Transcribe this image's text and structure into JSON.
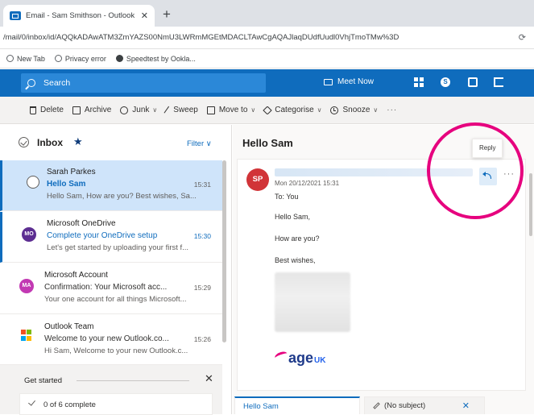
{
  "browser": {
    "tab_title": "Email - Sam Smithson - Outlook",
    "tab_close": "✕",
    "new_tab": "+",
    "url": "/mail/0/inbox/id/AQQkADAwATM3ZmYAZS00NmU3LWRmMGEtMDACLTAwCgAQAJlaqDUdfUudl0VhjTmoTMw%3D",
    "url_right_icon": "extensions-icon",
    "bookmarks": [
      {
        "label": "New Tab",
        "icon": "globe-icon"
      },
      {
        "label": "Privacy error",
        "icon": "globe-icon"
      },
      {
        "label": "Speedtest by Ookla...",
        "icon": "speedtest-icon"
      }
    ]
  },
  "header": {
    "search_placeholder": "Search",
    "meet_now": "Meet Now",
    "brand_color": "#0f6cbd"
  },
  "commands": {
    "delete": "Delete",
    "archive": "Archive",
    "junk": "Junk",
    "sweep": "Sweep",
    "move_to": "Move to",
    "categorise": "Categorise",
    "snooze": "Snooze",
    "more": "···"
  },
  "list": {
    "folder": "Inbox",
    "filter": "Filter",
    "messages": [
      {
        "initials": "",
        "sender": "Sarah Parkes",
        "subject": "Hello Sam",
        "time": "15:31",
        "preview": "Hello Sam, How are you? Best wishes, Sa..."
      },
      {
        "initials": "MO",
        "sender": "Microsoft OneDrive",
        "subject": "Complete your OneDrive setup",
        "time": "15:30",
        "preview": "Let's get started by uploading your first f..."
      },
      {
        "initials": "MA",
        "sender": "Microsoft Account",
        "subject": "Confirmation: Your Microsoft acc...",
        "time": "15:29",
        "preview": "Your one account for all things Microsoft..."
      },
      {
        "initials": "",
        "sender": "Outlook Team",
        "subject": "Welcome to your new Outlook.co...",
        "time": "15:26",
        "preview": "Hi Sam, Welcome to your new Outlook.c..."
      }
    ],
    "get_started": "Get started",
    "get_started_close": "✕",
    "progress_text": "0 of 6 complete",
    "progress_done": 0,
    "progress_total": 6
  },
  "reading": {
    "subject": "Hello Sam",
    "avatar": "SP",
    "date": "Mon 20/12/2021 15:31",
    "to": "To:  You",
    "body": [
      "Hello Sam,",
      "How are you?",
      "Best wishes,"
    ],
    "logo_age": "age",
    "logo_uk": "UK",
    "tooltip": "Reply",
    "msg_more": "···"
  },
  "bottom_tabs": {
    "tab1": "Hello Sam",
    "tab2": "(No subject)",
    "tab2_close": "✕"
  }
}
